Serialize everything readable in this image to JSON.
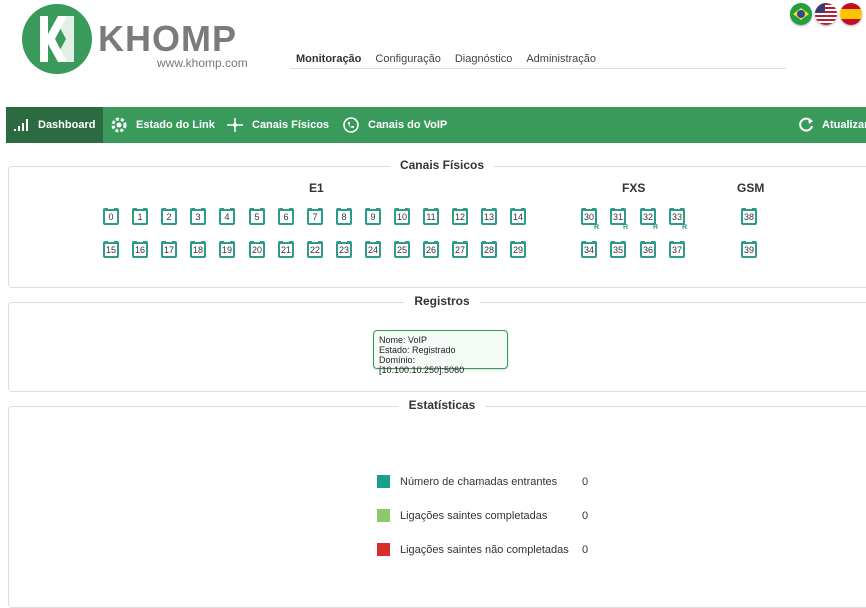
{
  "brand": {
    "name": "KHOMP",
    "url": "www.khomp.com"
  },
  "languages": [
    {
      "name": "Português",
      "icon": "flag-brazil-icon"
    },
    {
      "name": "English",
      "icon": "flag-usa-icon"
    },
    {
      "name": "Español",
      "icon": "flag-spain-icon"
    }
  ],
  "topnav": [
    "Monitoração",
    "Configuração",
    "Diagnóstico",
    "Administração"
  ],
  "menubar": {
    "items": [
      "Dashboard",
      "Estado do Link",
      "Canais Físicos",
      "Canais do VoIP"
    ],
    "refresh": "Atualizar"
  },
  "canais": {
    "title": "Canais Físicos",
    "groups": {
      "e1": "E1",
      "fxs": "FXS",
      "gsm": "GSM"
    },
    "e1_row1": [
      "0",
      "1",
      "2",
      "3",
      "4",
      "5",
      "6",
      "7",
      "8",
      "9",
      "10",
      "11",
      "12",
      "13",
      "14"
    ],
    "e1_row2": [
      "15",
      "16",
      "17",
      "18",
      "19",
      "20",
      "21",
      "22",
      "23",
      "24",
      "25",
      "26",
      "27",
      "28",
      "29"
    ],
    "fxs_row1": [
      "30",
      "31",
      "32",
      "33"
    ],
    "fxs_row2": [
      "34",
      "35",
      "36",
      "37"
    ],
    "gsm": [
      "38",
      "39"
    ],
    "r_mark": "R"
  },
  "registros": {
    "title": "Registros",
    "line1": "Nome: VoIP",
    "line2": "Estado: Registrado",
    "line3": "Domínio: [10.100.10.250]:5060"
  },
  "estatisticas": {
    "title": "Estatísticas",
    "rows": [
      {
        "label": "Número de chamadas entrantes",
        "value": "0",
        "color": "#1a9e8e"
      },
      {
        "label": "Ligações saintes completadas",
        "value": "0",
        "color": "#8dc96a"
      },
      {
        "label": "Ligações saintes não completadas",
        "value": "0",
        "color": "#d62d2d"
      }
    ]
  },
  "colors": {
    "accent": "#3a9a5c",
    "active": "#2c6b42",
    "port": "#2e9a8a"
  }
}
